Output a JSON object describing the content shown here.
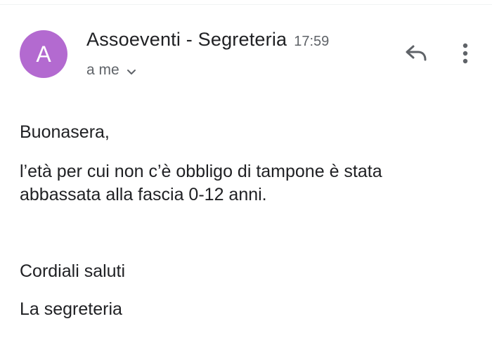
{
  "email": {
    "sender": {
      "initial": "A",
      "avatar_color": "#b36ad0",
      "name": "Assoeventi - Segreteria",
      "time": "17:59"
    },
    "recipient_label": "a me",
    "body": {
      "greeting": "Buonasera,",
      "message_line1": "l’età per cui non c’è obbligo di tampone è stata",
      "message_line2": "abbassata alla fascia 0-12 anni.",
      "closing": "Cordiali saluti",
      "signature": "La segreteria"
    }
  },
  "icons": {
    "reply": "reply-icon",
    "more": "more-vert-icon",
    "chevron": "chevron-down-icon"
  },
  "colors": {
    "text_primary": "#202124",
    "text_secondary": "#5f6368"
  }
}
